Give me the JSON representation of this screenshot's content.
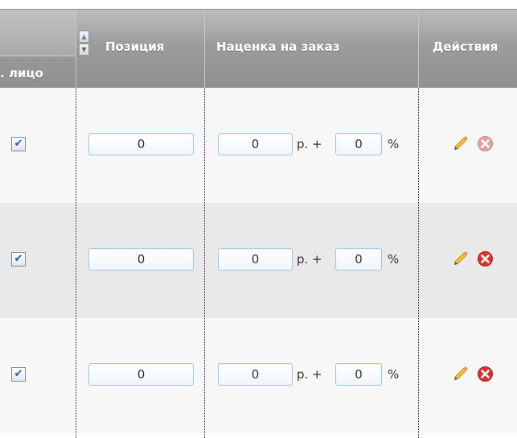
{
  "columns": {
    "legal_entity": ". лицо",
    "position": "Позиция",
    "markup": "Наценка на заказ",
    "actions": "Действия"
  },
  "sort": {
    "up_icon": "sort-asc-icon",
    "down_icon": "sort-desc-icon"
  },
  "units": {
    "rub": "р. +",
    "percent": "%"
  },
  "rows": [
    {
      "checked": true,
      "position": "0",
      "markup_rub": "0",
      "markup_percent": "0",
      "delete_style": "faded"
    },
    {
      "checked": true,
      "position": "0",
      "markup_rub": "0",
      "markup_percent": "0",
      "delete_style": "active"
    },
    {
      "checked": true,
      "position": "0",
      "markup_rub": "0",
      "markup_percent": "0",
      "delete_style": "active"
    }
  ],
  "colors": {
    "header_bg": "#9c9c9c",
    "row_odd": "#f7f7f7",
    "row_even": "#e9e9e9",
    "input_border": "#9ec7e3",
    "check_mark": "#1f5dad",
    "delete_red": "#d9332b",
    "delete_faded": "#e6a0a0"
  },
  "icons": {
    "edit": "pencil-icon",
    "delete": "delete-icon",
    "check": "checkmark-icon"
  }
}
